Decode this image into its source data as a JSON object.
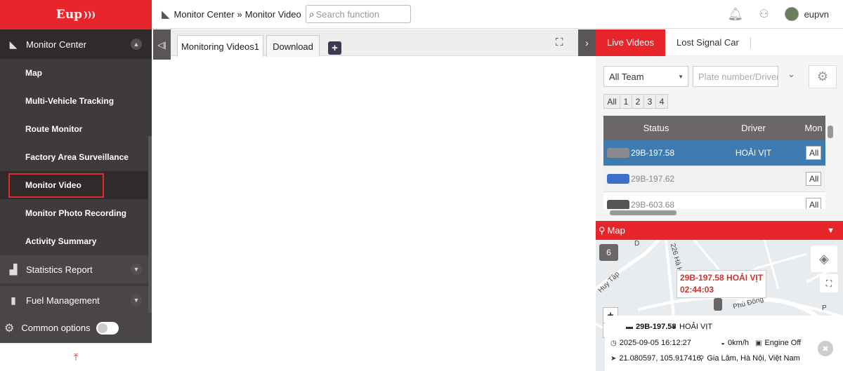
{
  "logo": {
    "text": "Eup"
  },
  "breadcrumb": {
    "root": "Monitor Center",
    "sep": "»",
    "current": "Monitor Video"
  },
  "search": {
    "placeholder": "Search function"
  },
  "user": {
    "name": "eupvn"
  },
  "sidebar": {
    "monitor_center": "Monitor Center",
    "items": [
      "Map",
      "Multi-Vehicle Tracking",
      "Route Monitor",
      "Factory Area Surveillance",
      "Monitor Video",
      "Monitor Photo Recording",
      "Activity Summary"
    ],
    "statistics": "Statistics Report",
    "fuel": "Fuel Management",
    "common": "Common options"
  },
  "tabs": {
    "t1": "Monitoring Videos1",
    "t2": "Download"
  },
  "right_tabs": {
    "live": "Live Videos",
    "lost": "Lost Signal Car"
  },
  "filters": {
    "team": "All Team",
    "plate_placeholder": "Plate number/Driver",
    "pages": [
      "All",
      "1",
      "2",
      "3",
      "4"
    ]
  },
  "table": {
    "headers": [
      "Status",
      "Driver",
      "Mon"
    ],
    "rows": [
      {
        "plate": "29B-197.58",
        "driver": "HOẢI VỊT",
        "action": "All",
        "color": "#8a8a8a"
      },
      {
        "plate": "29B-197.62",
        "driver": "",
        "action": "All",
        "color": "#3b6fc9"
      },
      {
        "plate": "29B-603.68",
        "driver": "",
        "action": "All",
        "color": "#555555"
      }
    ]
  },
  "map": {
    "title": "Map",
    "cluster": "6",
    "roads": {
      "r1": "Huy Tập",
      "r2": "226 Hà Huy Tập",
      "r3": "Phú Đông",
      "r4": "D",
      "r5": "P"
    },
    "popup": {
      "line1": "29B-197.58 HOẢI VỊT",
      "line2": "02:44:03"
    },
    "info": {
      "plate": "29B-197.58",
      "driver": "HOẢI VỊT",
      "time": "2025-09-05 16:12:27",
      "speed": "0km/h",
      "engine": "Engine Off",
      "coords": "21.080597, 105.917416",
      "address": "Gia Lâm, Hà Nội, Việt Nam"
    }
  }
}
